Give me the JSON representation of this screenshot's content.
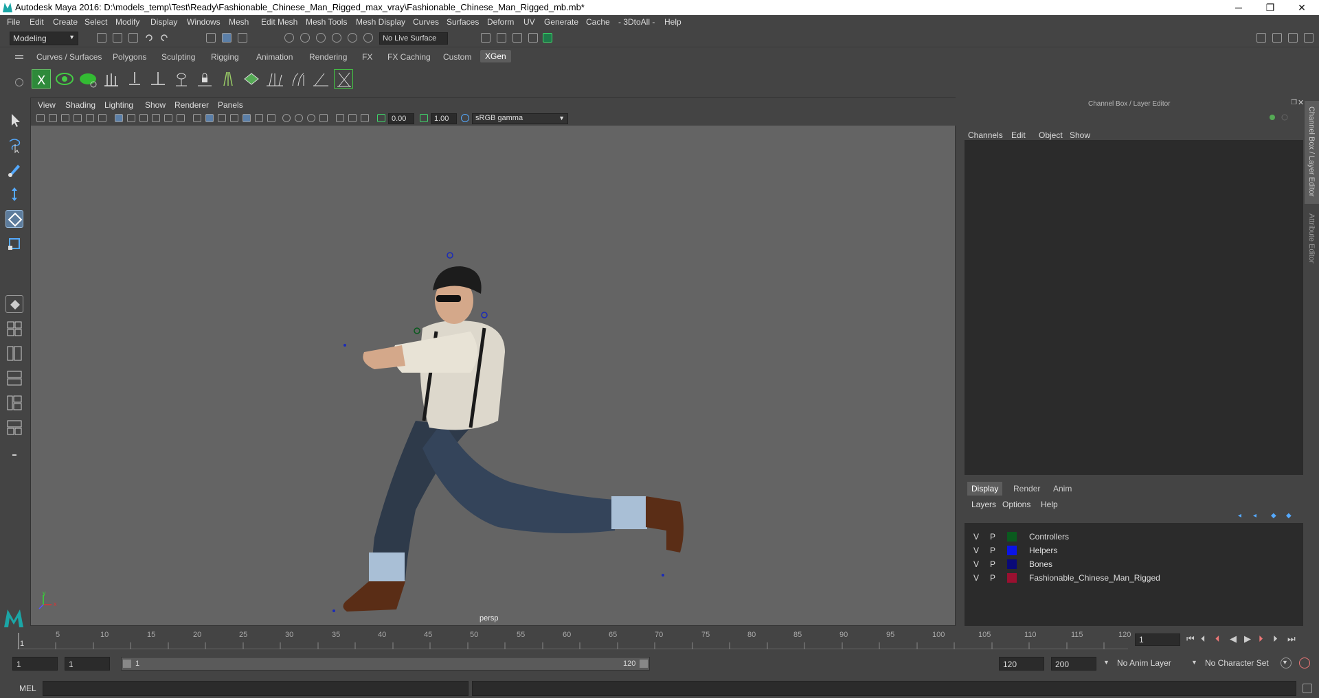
{
  "window": {
    "title": "Autodesk Maya 2016: D:\\models_temp\\Test\\Ready\\Fashionable_Chinese_Man_Rigged_max_vray\\Fashionable_Chinese_Man_Rigged_mb.mb*",
    "minimize": "─",
    "restore": "❐",
    "close": "✕"
  },
  "menubar": [
    "File",
    "Edit",
    "Create",
    "Select",
    "Modify",
    "Display",
    "Windows",
    "Mesh",
    "Edit Mesh",
    "Mesh Tools",
    "Mesh Display",
    "Curves",
    "Surfaces",
    "Deform",
    "UV",
    "Generate",
    "Cache",
    "- 3DtoAll -",
    "Help"
  ],
  "toolbar": {
    "mode_dropdown": "Modeling",
    "live_surface": "No Live Surface"
  },
  "shelf_tabs": [
    "Curves / Surfaces",
    "Polygons",
    "Sculpting",
    "Rigging",
    "Animation",
    "Rendering",
    "FX",
    "FX Caching",
    "Custom",
    "XGen"
  ],
  "active_shelf_tab": "XGen",
  "viewport": {
    "menu": [
      "View",
      "Shading",
      "Lighting",
      "Show",
      "Renderer",
      "Panels"
    ],
    "exposure": "0.00",
    "gamma": "1.00",
    "color_space": "sRGB gamma",
    "camera_label": "persp",
    "axis_x": "x",
    "axis_y": "y"
  },
  "channel_box": {
    "header": "Channel Box / Layer Editor",
    "menu": [
      "Channels",
      "Edit",
      "Object",
      "Show"
    ],
    "layer_tabs": [
      "Display",
      "Render",
      "Anim"
    ],
    "active_layer_tab": "Display",
    "layer_menu": [
      "Layers",
      "Options",
      "Help"
    ],
    "layers": [
      {
        "v": "V",
        "p": "P",
        "name": "Controllers",
        "color": "#0a5a1e"
      },
      {
        "v": "V",
        "p": "P",
        "name": "Helpers",
        "color": "#0a14e6"
      },
      {
        "v": "V",
        "p": "P",
        "name": "Bones",
        "color": "#0a0a78"
      },
      {
        "v": "V",
        "p": "P",
        "name": "Fashionable_Chinese_Man_Rigged",
        "color": "#9a1030"
      }
    ]
  },
  "side_tabs": [
    "Channel Box / Layer Editor",
    "Attribute Editor"
  ],
  "timeline": {
    "ticks": [
      "5",
      "10",
      "15",
      "20",
      "25",
      "30",
      "35",
      "40",
      "45",
      "50",
      "55",
      "60",
      "65",
      "70",
      "75",
      "80",
      "85",
      "90",
      "95",
      "100",
      "105",
      "110",
      "115",
      "120"
    ],
    "start_marker": "1",
    "current_frame": "1"
  },
  "range": {
    "start": "1",
    "playback_start": "1",
    "slider_start": "1",
    "slider_end": "120",
    "playback_end": "120",
    "end": "200",
    "anim_layer": "No Anim Layer",
    "character_set": "No Character Set"
  },
  "command_line": {
    "label": "MEL"
  }
}
